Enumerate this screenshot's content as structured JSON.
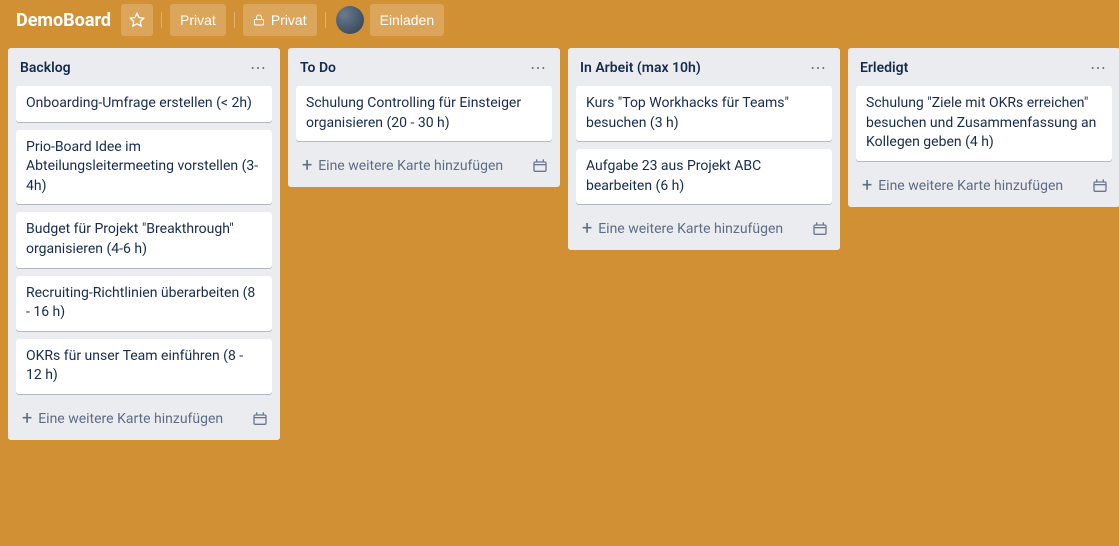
{
  "header": {
    "title": "DemoBoard",
    "workspace_label": "Privat",
    "visibility_label": "Privat",
    "invite_label": "Einladen"
  },
  "add_card_label": "Eine weitere Karte hinzufügen",
  "lists": [
    {
      "title": "Backlog",
      "cards": [
        "Onboarding-Umfrage erstellen (< 2h)",
        "Prio-Board Idee im Abteilungsleitermeeting vorstellen (3-4h)",
        "Budget für Projekt \"Breakthrough\" organisieren (4-6 h)",
        "Recruiting-Richtlinien überarbeiten (8 - 16 h)",
        "OKRs für unser Team einführen (8 - 12 h)"
      ]
    },
    {
      "title": "To Do",
      "cards": [
        "Schulung Controlling für Einsteiger organisieren (20 - 30 h)"
      ]
    },
    {
      "title": "In Arbeit (max 10h)",
      "cards": [
        "Kurs \"Top Workhacks für Teams\" besuchen (3 h)",
        "Aufgabe 23 aus Projekt ABC bearbeiten (6 h)"
      ]
    },
    {
      "title": "Erledigt",
      "cards": [
        "Schulung \"Ziele mit OKRs erreichen\" besuchen und Zusammenfassung an Kollegen geben (4 h)"
      ]
    }
  ]
}
